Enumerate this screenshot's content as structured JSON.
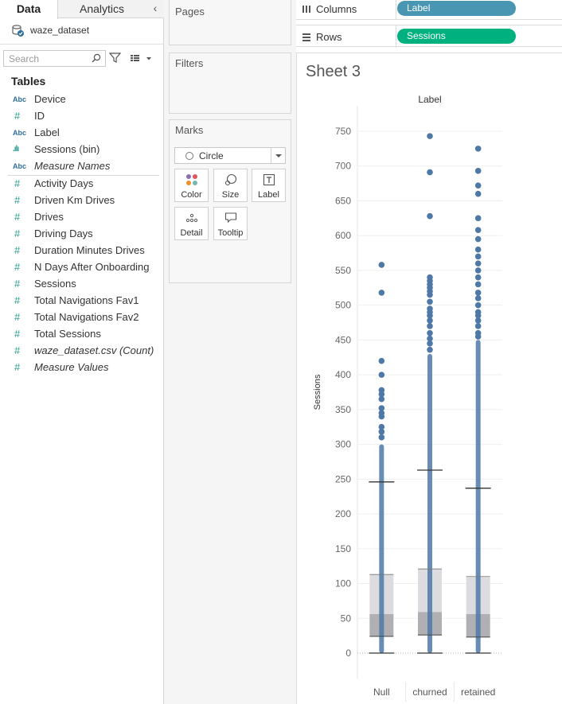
{
  "data_pane": {
    "tabs": [
      "Data",
      "Analytics"
    ],
    "collapse_icon": "chevron-left-icon",
    "datasource": "waze_dataset",
    "search_placeholder": "Search",
    "tables_heading": "Tables",
    "dimensions": [
      {
        "name": "Device",
        "type": "Abc"
      },
      {
        "name": "ID",
        "type": "#"
      },
      {
        "name": "Label",
        "type": "Abc"
      },
      {
        "name": "Sessions (bin)",
        "type": ".ılı"
      },
      {
        "name": "Measure Names",
        "type": "Abc",
        "italic": true
      }
    ],
    "measures": [
      {
        "name": "Activity Days"
      },
      {
        "name": "Driven Km Drives"
      },
      {
        "name": "Drives"
      },
      {
        "name": "Driving Days"
      },
      {
        "name": "Duration Minutes Drives"
      },
      {
        "name": "N Days After Onboarding"
      },
      {
        "name": "Sessions"
      },
      {
        "name": "Total Navigations Fav1"
      },
      {
        "name": "Total Navigations Fav2"
      },
      {
        "name": "Total Sessions"
      },
      {
        "name": "waze_dataset.csv (Count)",
        "italic": true
      },
      {
        "name": "Measure Values",
        "italic": true
      }
    ]
  },
  "cards": {
    "pages": "Pages",
    "filters": "Filters",
    "marks": "Marks",
    "mark_type": "Circle",
    "mark_buttons": [
      "Color",
      "Size",
      "Label",
      "Detail",
      "Tooltip"
    ]
  },
  "shelves": {
    "columns_label": "Columns",
    "columns_pill": "Label",
    "rows_label": "Rows",
    "rows_pill": "Sessions"
  },
  "sheet": {
    "title": "Sheet 3"
  },
  "chart_data": {
    "type": "scatter",
    "subtype": "jittered strip with box plot",
    "column_header": "Label",
    "ylabel": "Sessions",
    "categories": [
      "Null",
      "churned",
      "retained"
    ],
    "ylim": [
      -20,
      770
    ],
    "yticks": [
      0,
      50,
      100,
      150,
      200,
      250,
      300,
      350,
      400,
      450,
      500,
      550,
      600,
      650,
      700,
      750
    ],
    "grid": true,
    "mark_color": "#4e79a7",
    "box_plot": [
      {
        "category": "Null",
        "whisker_low": 0,
        "q1": 24,
        "median": 56,
        "q3": 113,
        "whisker_high": 246
      },
      {
        "category": "churned",
        "whisker_low": 0,
        "q1": 26,
        "median": 59,
        "q3": 121,
        "whisker_high": 263
      },
      {
        "category": "retained",
        "whisker_low": 0,
        "q1": 23,
        "median": 56,
        "q3": 110,
        "whisker_high": 237
      }
    ],
    "series": [
      {
        "category": "Null",
        "dense_range": [
          0,
          300
        ],
        "outliers": [
          310,
          318,
          325,
          340,
          345,
          352,
          365,
          372,
          378,
          400,
          420,
          518,
          558
        ]
      },
      {
        "category": "churned",
        "dense_range": [
          0,
          430
        ],
        "outliers": [
          436,
          445,
          452,
          460,
          470,
          478,
          485,
          490,
          495,
          505,
          515,
          520,
          525,
          530,
          535,
          540,
          628,
          691,
          743
        ]
      },
      {
        "category": "retained",
        "dense_range": [
          0,
          450
        ],
        "outliers": [
          455,
          460,
          470,
          478,
          485,
          490,
          500,
          510,
          518,
          530,
          540,
          550,
          560,
          570,
          580,
          595,
          608,
          625,
          660,
          672,
          693,
          725
        ]
      }
    ]
  },
  "colors": {
    "dimension_icon": "#2f6f9f",
    "measure_icon": "#2a9d8f",
    "columns_pill": "#4996b2",
    "rows_pill": "#00b180",
    "marks": "#4e79a7",
    "box_upper": "#dcdce0",
    "box_lower": "#b0b0b4"
  }
}
